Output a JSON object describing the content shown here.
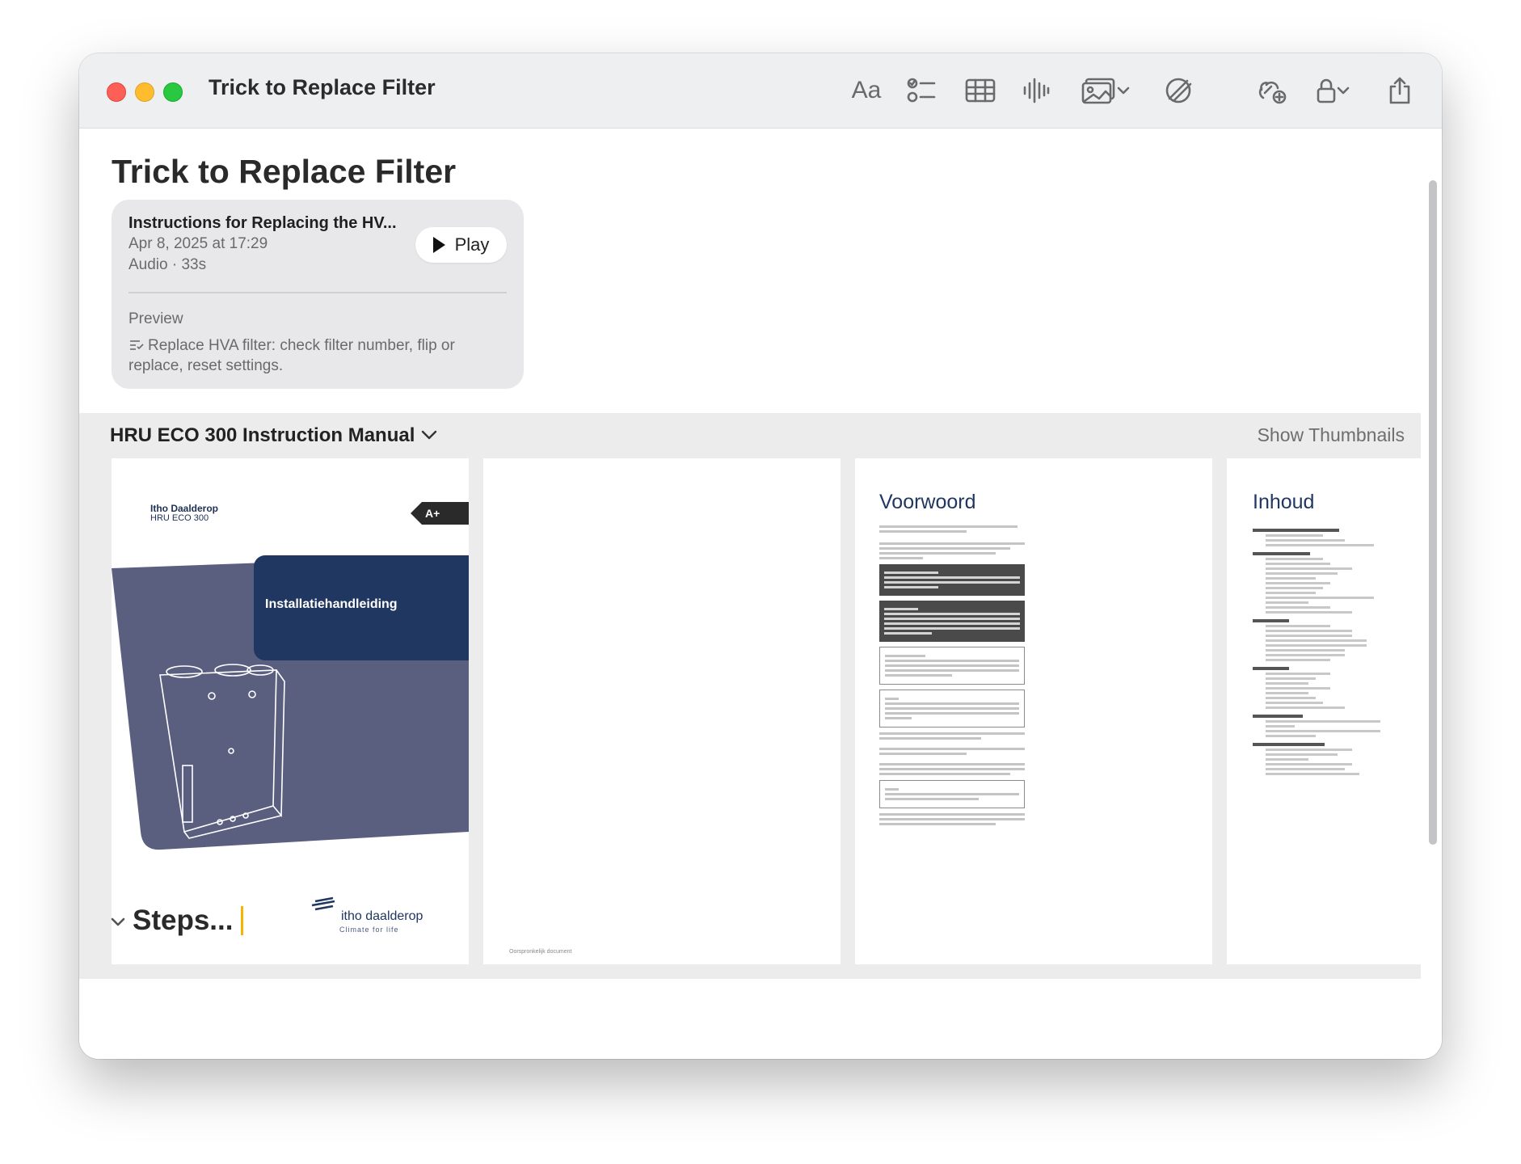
{
  "window": {
    "title": "Trick to Replace Filter"
  },
  "toolbar": {
    "format_label": "Aa",
    "icons": [
      "format-icon",
      "checklist-icon",
      "table-icon",
      "audio-waveform-icon",
      "media-icon",
      "markup-icon",
      "collaborate-icon",
      "lock-icon",
      "share-icon"
    ]
  },
  "note": {
    "title": "Trick to Replace Filter",
    "audio_card": {
      "title": "Instructions for Replacing the HV...",
      "date": "Apr 8, 2025 at 17:29",
      "meta": "Audio · 33s",
      "play_label": "Play",
      "preview_label": "Preview",
      "preview_text": "Replace HVA filter: check filter number, flip or replace, reset settings."
    },
    "attachment": {
      "name": "HRU ECO 300 Instruction Manual",
      "show_thumbnails_label": "Show Thumbnails",
      "pages": {
        "cover": {
          "brand": "Itho Daalderop",
          "model": "HRU ECO 300",
          "energy_label": "A+",
          "subtitle": "Installatiehandleiding",
          "logo": "itho daalderop",
          "tagline": "Climate for life"
        },
        "blank": {
          "footer": "Oorspronkelijk document"
        },
        "preface": {
          "heading": "Voorwoord"
        },
        "toc": {
          "heading": "Inhoud"
        }
      }
    },
    "steps_heading": "Steps..."
  },
  "colors": {
    "accent_navy": "#203762",
    "cover_slate": "#5a5f80",
    "close": "#fe5f57",
    "minimize": "#febc2e",
    "maximize": "#28c840"
  }
}
